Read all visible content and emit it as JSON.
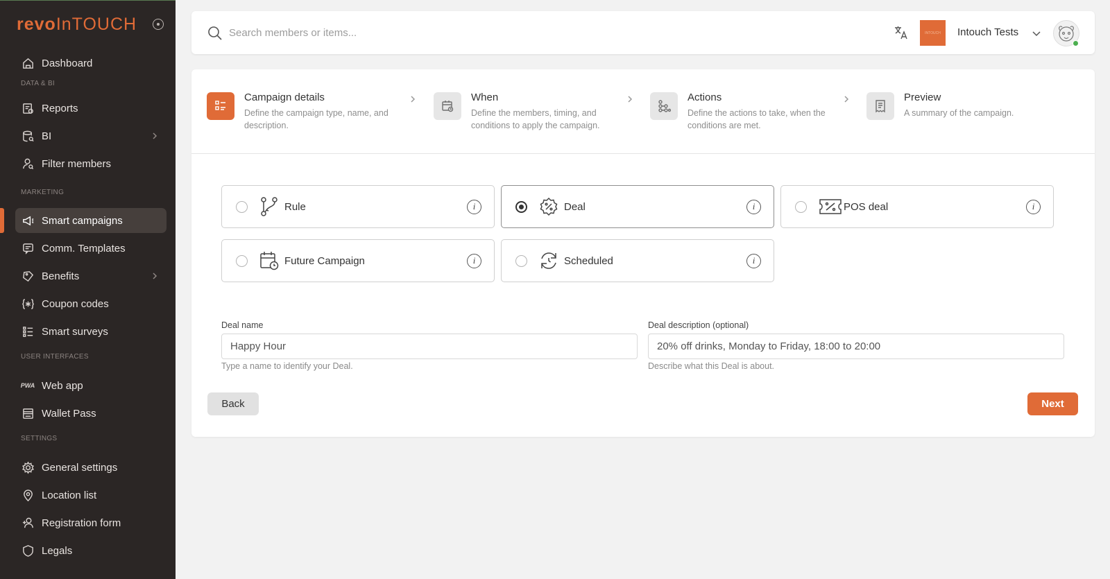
{
  "brand": {
    "logo_part1": "revo",
    "logo_part2": "InTOUCH"
  },
  "sidebar": {
    "sections": {
      "data_bi": "DATA & BI",
      "marketing": "MARKETING",
      "user_interfaces": "USER INTERFACES",
      "settings": "SETTINGS"
    },
    "items": [
      {
        "label": "Dashboard",
        "icon": "home-icon"
      },
      {
        "label": "Reports",
        "icon": "reports-icon"
      },
      {
        "label": "BI",
        "icon": "database-search-icon",
        "has_submenu": true
      },
      {
        "label": "Filter members",
        "icon": "user-search-icon"
      },
      {
        "label": "Smart campaigns",
        "icon": "megaphone-icon",
        "active": true
      },
      {
        "label": "Comm. Templates",
        "icon": "message-icon"
      },
      {
        "label": "Benefits",
        "icon": "tag-icon",
        "has_submenu": true
      },
      {
        "label": "Coupon codes",
        "icon": "code-asterisk-icon"
      },
      {
        "label": "Smart surveys",
        "icon": "list-icon"
      },
      {
        "label": "Web app",
        "icon": "pwa-icon"
      },
      {
        "label": "Wallet Pass",
        "icon": "wallet-icon"
      },
      {
        "label": "General settings",
        "icon": "gear-icon"
      },
      {
        "label": "Location list",
        "icon": "location-pin-icon"
      },
      {
        "label": "Registration form",
        "icon": "user-add-icon"
      },
      {
        "label": "Legals",
        "icon": "shield-icon"
      }
    ]
  },
  "topbar": {
    "search_placeholder": "Search members or items...",
    "account_name": "Intouch Tests",
    "brand_logo_text": "INTOUCH"
  },
  "stepper": {
    "steps": [
      {
        "title": "Campaign details",
        "desc": "Define the campaign type, name, and description.",
        "active": true
      },
      {
        "title": "When",
        "desc": "Define the members, timing, and conditions to apply the campaign."
      },
      {
        "title": "Actions",
        "desc": "Define the actions to take, when the conditions are met."
      },
      {
        "title": "Preview",
        "desc": "A summary of the campaign."
      }
    ]
  },
  "campaign_types": [
    {
      "label": "Rule",
      "icon": "branch-icon",
      "selected": false
    },
    {
      "label": "Deal",
      "icon": "discount-badge-icon",
      "selected": true
    },
    {
      "label": "POS deal",
      "icon": "ticket-percent-icon",
      "selected": false
    },
    {
      "label": "Future Campaign",
      "icon": "calendar-clock-icon",
      "selected": false
    },
    {
      "label": "Scheduled",
      "icon": "refresh-clock-icon",
      "selected": false
    }
  ],
  "form": {
    "name_label": "Deal name",
    "name_value": "Happy Hour",
    "name_help": "Type a name to identify your Deal.",
    "desc_label": "Deal description (optional)",
    "desc_value": "20% off drinks, Monday to Friday, 18:00 to 20:00",
    "desc_help": "Describe what this Deal is about."
  },
  "buttons": {
    "back": "Back",
    "next": "Next"
  },
  "colors": {
    "accent": "#e06b37",
    "sidebar_bg": "#2b2625"
  }
}
